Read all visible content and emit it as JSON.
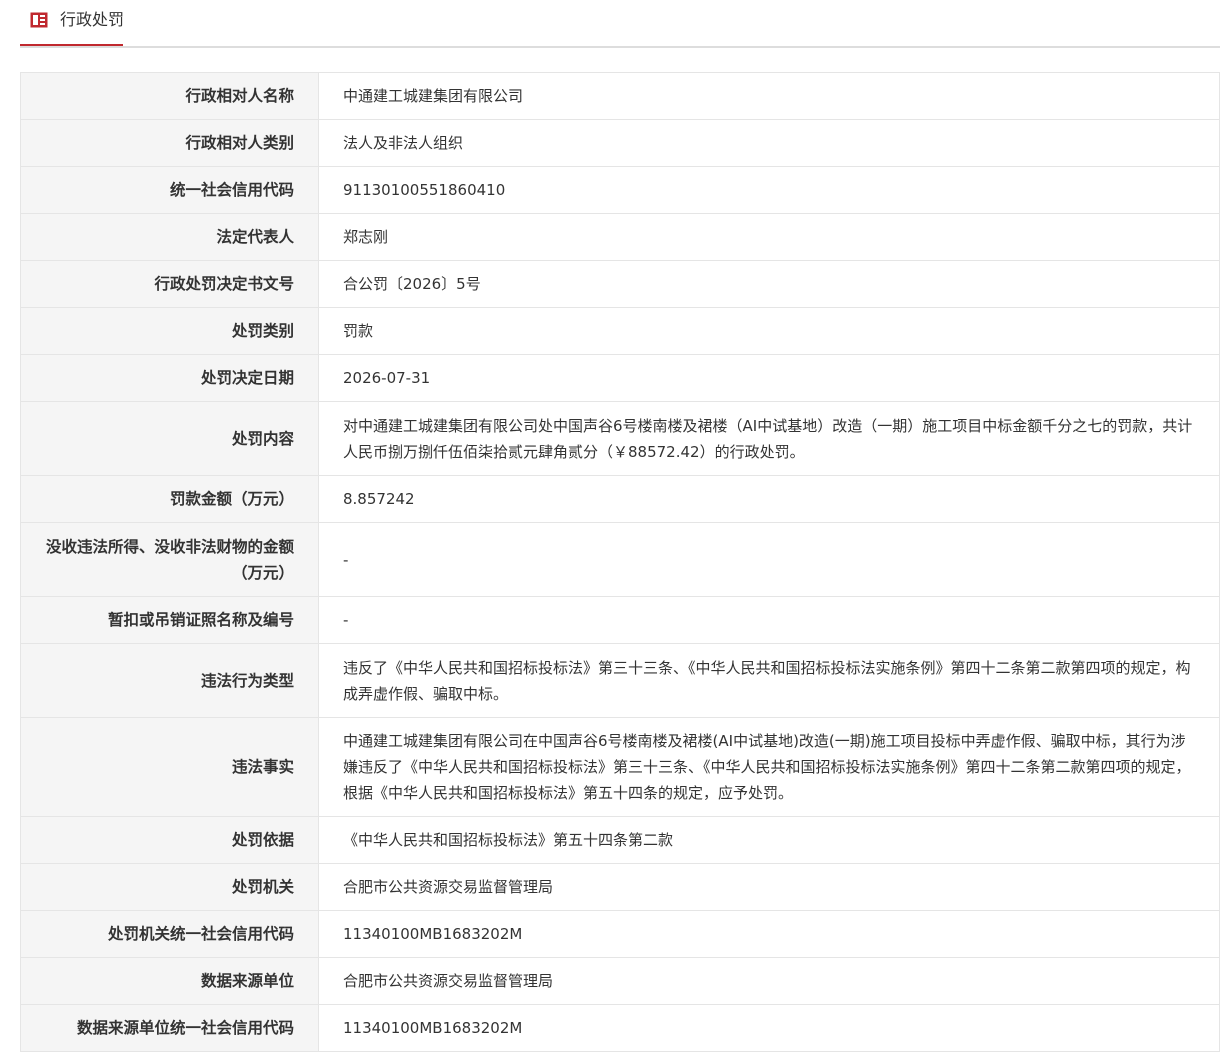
{
  "tab": {
    "label": "行政处罚",
    "icon": "document-list-icon",
    "accent_color": "#c0282e"
  },
  "rows": [
    {
      "key": "行政相对人名称",
      "value": "中通建工城建集团有限公司"
    },
    {
      "key": "行政相对人类别",
      "value": "法人及非法人组织"
    },
    {
      "key": "统一社会信用代码",
      "value": "91130100551860410"
    },
    {
      "key": "法定代表人",
      "value": "郑志刚"
    },
    {
      "key": "行政处罚决定书文号",
      "value": "合公罚〔2026〕5号"
    },
    {
      "key": "处罚类别",
      "value": "罚款"
    },
    {
      "key": "处罚决定日期",
      "value": "2026-07-31"
    },
    {
      "key": "处罚内容",
      "value": "对中通建工城建集团有限公司处中国声谷6号楼南楼及裙楼（AI中试基地）改造（一期）施工项目中标金额千分之七的罚款，共计人民币捌万捌仟伍佰柒拾贰元肆角贰分（￥88572.42）的行政处罚。"
    },
    {
      "key": "罚款金额（万元）",
      "value": "8.857242"
    },
    {
      "key": "没收违法所得、没收非法财物的金额（万元）",
      "value": "-"
    },
    {
      "key": "暂扣或吊销证照名称及编号",
      "value": "-"
    },
    {
      "key": "违法行为类型",
      "value": "违反了《中华人民共和国招标投标法》第三十三条、《中华人民共和国招标投标法实施条例》第四十二条第二款第四项的规定，构成弄虚作假、骗取中标。"
    },
    {
      "key": "违法事实",
      "value": "中通建工城建集团有限公司在中国声谷6号楼南楼及裙楼(AI中试基地)改造(一期)施工项目投标中弄虚作假、骗取中标，其行为涉嫌违反了《中华人民共和国招标投标法》第三十三条、《中华人民共和国招标投标法实施条例》第四十二条第二款第四项的规定，根据《中华人民共和国招标投标法》第五十四条的规定，应予处罚。"
    },
    {
      "key": "处罚依据",
      "value": "《中华人民共和国招标投标法》第五十四条第二款"
    },
    {
      "key": "处罚机关",
      "value": "合肥市公共资源交易监督管理局"
    },
    {
      "key": "处罚机关统一社会信用代码",
      "value": "11340100MB1683202M"
    },
    {
      "key": "数据来源单位",
      "value": "合肥市公共资源交易监督管理局"
    },
    {
      "key": "数据来源单位统一社会信用代码",
      "value": "11340100MB1683202M"
    }
  ]
}
